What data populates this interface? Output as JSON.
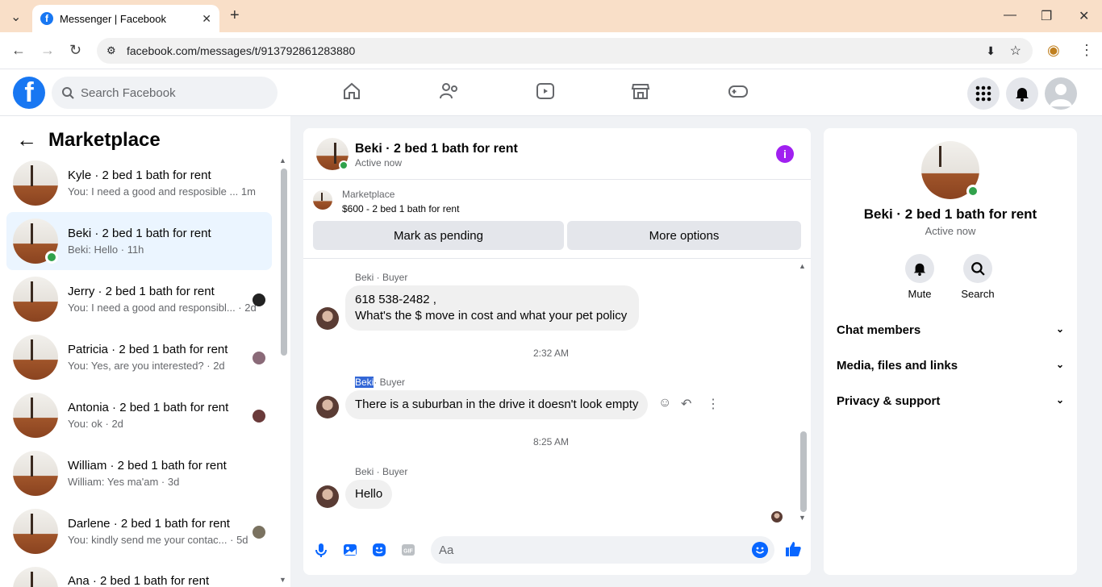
{
  "browser": {
    "tab_title": "Messenger | Facebook",
    "url": "facebook.com/messages/t/913792861283880"
  },
  "fb": {
    "search_placeholder": "Search Facebook",
    "brand_color": "#1877f2"
  },
  "left": {
    "title": "Marketplace",
    "conversations": [
      {
        "name": "Kyle · 2 bed 1 bath for rent",
        "preview": "You: I need a good and resposible ...",
        "time": "1m"
      },
      {
        "name": "Beki · 2 bed 1 bath for rent",
        "preview": "Beki: Hello · 11h",
        "time": ""
      },
      {
        "name": "Jerry · 2 bed 1 bath for rent",
        "preview": "You: I need a good and responsibl... · 2d",
        "time": ""
      },
      {
        "name": "Patricia · 2 bed 1 bath for rent",
        "preview": "You: Yes, are you interested? · 2d",
        "time": ""
      },
      {
        "name": "Antonia · 2 bed 1 bath for rent",
        "preview": "You: ok · 2d",
        "time": ""
      },
      {
        "name": "William · 2 bed 1 bath for rent",
        "preview": "William: Yes ma'am · 3d",
        "time": ""
      },
      {
        "name": "Darlene · 2 bed 1 bath for rent",
        "preview": "You: kindly send me your contac... · 5d",
        "time": ""
      },
      {
        "name": "Ana · 2 bed 1 bath for rent",
        "preview": "",
        "time": ""
      }
    ]
  },
  "chat": {
    "title": "Beki · 2 bed 1 bath for rent",
    "status": "Active now",
    "marketplace_label": "Marketplace",
    "listing": "$600 - 2 bed 1 bath for rent",
    "mark_pending": "Mark as pending",
    "more_options": "More options",
    "messages": [
      {
        "sender": "Beki",
        "role": " · Buyer",
        "line1": "618 538-2482 ,",
        "line2": "What's the $ move in cost and what your pet policy"
      },
      {
        "time": "2:32 AM"
      },
      {
        "sender": "Beki",
        "role": "· Buyer",
        "text": "There is a suburban in the drive it doesn't look empty"
      },
      {
        "time": "8:25 AM"
      },
      {
        "sender": "Beki",
        "role": " · Buyer",
        "text": "Hello"
      }
    ],
    "input_placeholder": "Aa"
  },
  "right": {
    "name": "Beki · 2 bed 1 bath for rent",
    "status": "Active now",
    "mute": "Mute",
    "search": "Search",
    "sections": [
      "Chat members",
      "Media, files and links",
      "Privacy & support"
    ]
  }
}
